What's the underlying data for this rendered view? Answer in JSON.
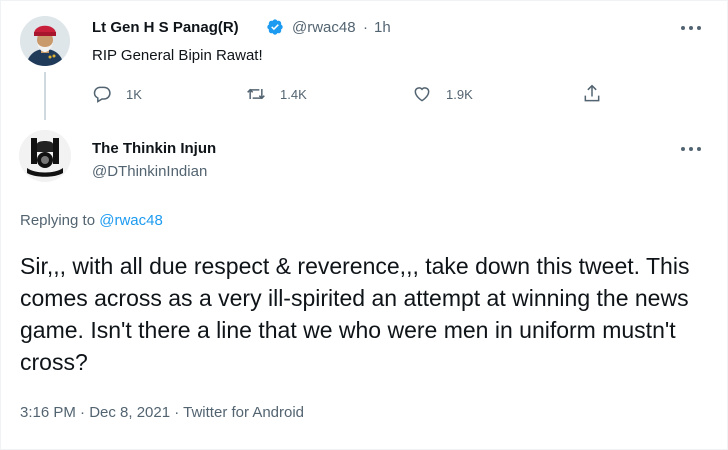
{
  "parent_tweet": {
    "author_name": "Lt Gen H S Panag(R)",
    "handle": "@rwac48",
    "separator": "·",
    "time": "1h",
    "text": "RIP General Bipin Rawat!",
    "actions": {
      "replies": "1K",
      "retweets": "1.4K",
      "likes": "1.9K"
    }
  },
  "reply_tweet": {
    "author_name": "The Thinkin Injun",
    "handle": "@DThinkinIndian",
    "replying_prefix": "Replying to",
    "replying_handle": "@rwac48",
    "text": "Sir,,, with all due respect & reverence,,, take down this tweet.  This comes across as a very ill-spirited an attempt at winning the news game. Isn't there a line that we who were men in uniform mustn't cross?",
    "timestamp": "3:16 PM · Dec 8, 2021 · Twitter for Android"
  },
  "colors": {
    "accent": "#1d9bf0",
    "text": "#0f1419",
    "muted": "#536471",
    "thread_line": "#cfd9de"
  },
  "icons": [
    "verified-badge-icon",
    "more-options-icon",
    "reply-icon",
    "retweet-icon",
    "like-icon",
    "share-icon"
  ]
}
